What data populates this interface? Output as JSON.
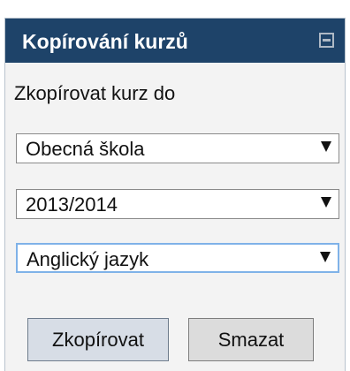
{
  "panel": {
    "title": "Kopírování kurzů",
    "collapse_icon": "minus-square-icon",
    "header_color": "#1e4369"
  },
  "form": {
    "caption": "Zkopírovat kurz do",
    "selects": [
      {
        "value": "Obecná škola"
      },
      {
        "value": "2013/2014"
      },
      {
        "value": "Anglický jazyk",
        "focused": true
      }
    ],
    "copy_button_label": "Zkopírovat",
    "delete_button_label": "Smazat"
  }
}
